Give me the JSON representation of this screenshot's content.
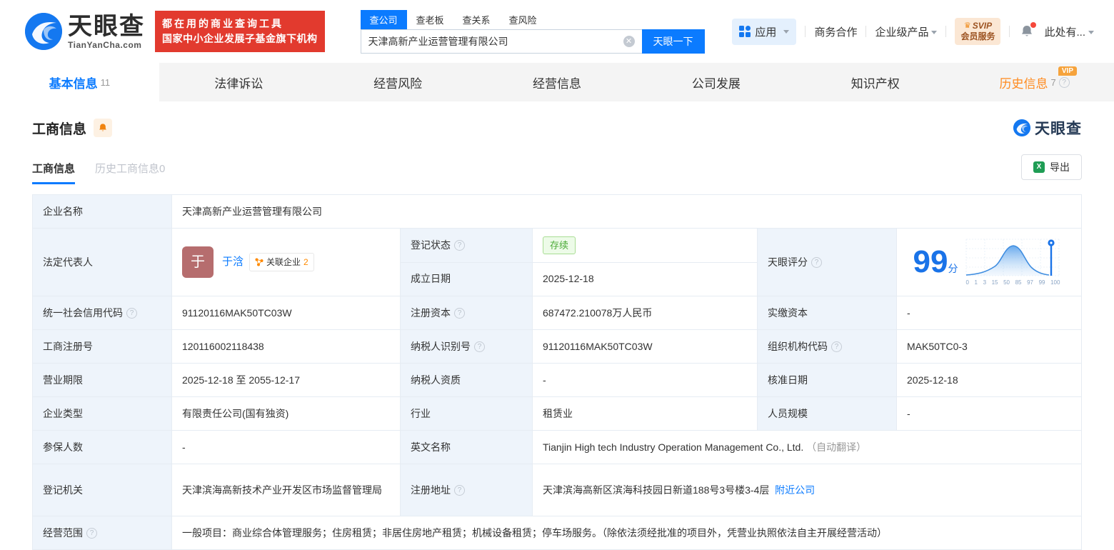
{
  "colors": {
    "accent": "#0b7bff",
    "brand_red": "#e23a2e",
    "status_green": "#4cab38",
    "vip_orange": "#f6a33c",
    "score_blue": "#1a73e8"
  },
  "header": {
    "logo": {
      "brand": "天眼查",
      "domain": "TianYanCha.com"
    },
    "slogan_line1": "都在用的商业查询工具",
    "slogan_line2": "国家中小企业发展子基金旗下机构",
    "search": {
      "tabs": [
        {
          "label": "查公司",
          "active": true
        },
        {
          "label": "查老板",
          "active": false
        },
        {
          "label": "查关系",
          "active": false
        },
        {
          "label": "查风险",
          "active": false
        }
      ],
      "value": "天津高新产业运营管理有限公司",
      "button": "天眼一下"
    },
    "nav": {
      "apps": "应用",
      "cooperation": "商务合作",
      "enterprise": "企业级产品",
      "svip_line1": "SVIP",
      "svip_line2": "会员服务",
      "user": "此处有..."
    }
  },
  "tabs": [
    {
      "label": "基本信息",
      "count": "11"
    },
    {
      "label": "法律诉讼"
    },
    {
      "label": "经营风险"
    },
    {
      "label": "经营信息"
    },
    {
      "label": "公司发展"
    },
    {
      "label": "知识产权"
    },
    {
      "label": "历史信息",
      "count": "7",
      "vip": "VIP"
    }
  ],
  "section": {
    "title": "工商信息",
    "subtabs": [
      {
        "label": "工商信息",
        "active": true
      },
      {
        "label": "历史工商信息0",
        "active": false
      }
    ],
    "export_label": "导出",
    "watermark": "天眼查"
  },
  "company": {
    "name_label": "企业名称",
    "name": "天津高新产业运营管理有限公司",
    "legal_rep_label": "法定代表人",
    "legal_rep_avatar": "于",
    "legal_rep": "于浛",
    "related_label": "关联企业",
    "related_count": "2",
    "reg_status_label": "登记状态",
    "reg_status": "存续",
    "est_date_label": "成立日期",
    "est_date": "2025-12-18",
    "credit_code_label": "统一社会信用代码",
    "credit_code": "91120116MAK50TC03W",
    "reg_capital_label": "注册资本",
    "reg_capital": "687472.210078万人民币",
    "paid_capital_label": "实缴资本",
    "paid_capital": "-",
    "reg_number_label": "工商注册号",
    "reg_number": "120116002118438",
    "taxpayer_id_label": "纳税人识别号",
    "taxpayer_id": "91120116MAK50TC03W",
    "org_code_label": "组织机构代码",
    "org_code": "MAK50TC0-3",
    "business_term_label": "营业期限",
    "business_term": "2025-12-18 至 2055-12-17",
    "taxpayer_quality_label": "纳税人资质",
    "taxpayer_quality": "-",
    "approval_date_label": "核准日期",
    "approval_date": "2025-12-18",
    "company_type_label": "企业类型",
    "company_type": "有限责任公司(国有独资)",
    "industry_label": "行业",
    "industry": "租赁业",
    "staff_size_label": "人员规模",
    "staff_size": "-",
    "insured_label": "参保人数",
    "insured": "-",
    "english_name_label": "英文名称",
    "english_name": "Tianjin High tech Industry Operation Management Co., Ltd.",
    "english_name_note": "（自动翻译）",
    "registry_label": "登记机关",
    "registry": "天津滨海高新技术产业开发区市场监督管理局",
    "address_label": "注册地址",
    "address": "天津滨海高新区滨海科技园日新道188号3号楼3-4层",
    "nearby_link": "附近公司",
    "scope_label": "经营范围",
    "scope": "一般项目：商业综合体管理服务；住房租赁；非居住房地产租赁；机械设备租赁；停车场服务。（除依法须经批准的项目外，凭营业执照依法自主开展经营活动）"
  },
  "score": {
    "label": "天眼评分",
    "value": "99",
    "unit": "分"
  },
  "chart_data": {
    "type": "area",
    "title": "天眼评分分布曲线",
    "x_ticks": [
      "0",
      "1",
      "3",
      "15",
      "50",
      "85",
      "97",
      "99",
      "100"
    ],
    "marker_at": "99",
    "score": 99,
    "curve_shape": "bell curve peaking near tick 50, marker pin at 99"
  }
}
